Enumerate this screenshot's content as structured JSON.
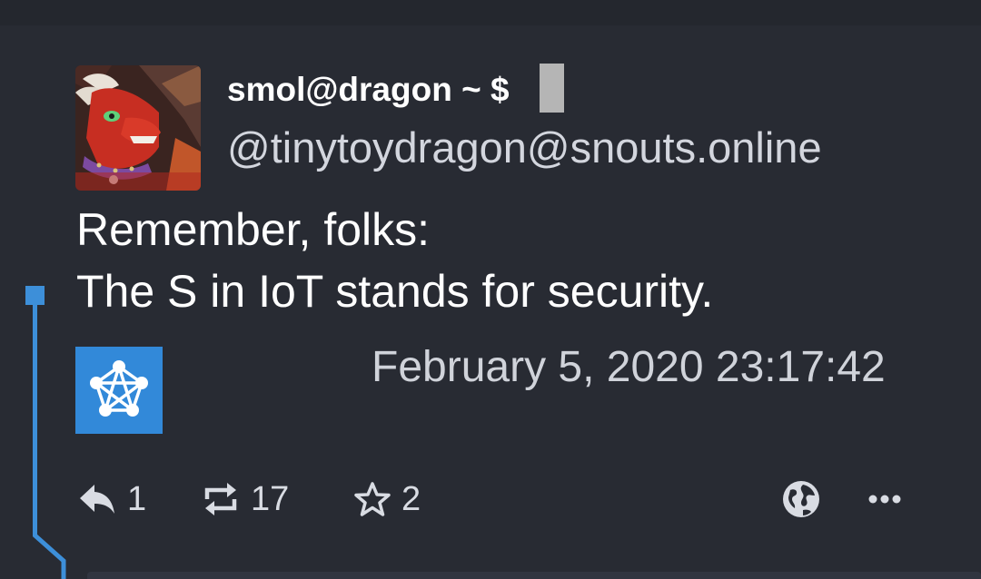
{
  "post": {
    "display_name": "smol@dragon ~ $",
    "handle": "@tinytoydragon@snouts.online",
    "content_lines": [
      "Remember, folks:",
      "The S in IoT stands for security."
    ],
    "timestamp": "February 5, 2020 23:17:42",
    "avatar_icon": "dragon-avatar",
    "app_icon": "fediverse-pentagram-icon"
  },
  "actions": {
    "reply_count": "1",
    "boost_count": "17",
    "favourite_count": "2",
    "visibility_icon": "globe-icon",
    "more_icon": "ellipsis-icon"
  },
  "colors": {
    "background": "#282b33",
    "thread_line": "#3d8fd9",
    "app_icon_bg": "#3289d9",
    "text": "#ffffff",
    "muted_text": "#d0d3da"
  }
}
